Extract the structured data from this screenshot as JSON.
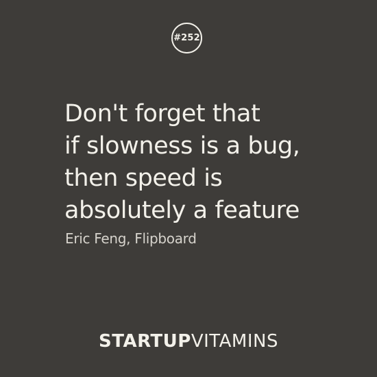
{
  "badge": {
    "label": "#252"
  },
  "quote": {
    "lines": [
      "Don't forget that",
      "if slowness is a bug,",
      "then speed is",
      "absolutely a feature"
    ]
  },
  "author": "Eric Feng, Flipboard",
  "brand": {
    "bold": "STARTUP",
    "light": "VITAMINS"
  },
  "colors": {
    "background": "#3e3c39",
    "text": "#f3f1ea"
  }
}
